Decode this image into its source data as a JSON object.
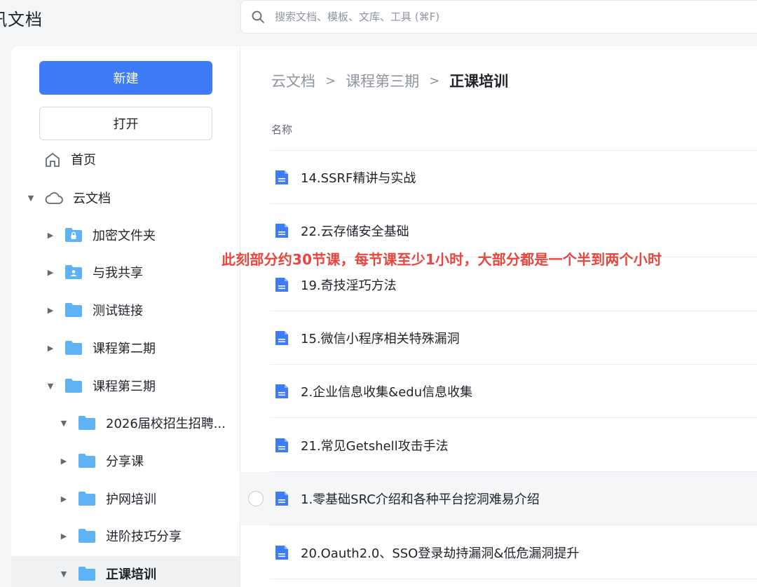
{
  "app": {
    "title": "讯文档"
  },
  "search": {
    "placeholder": "搜索文档、模板、文库、工具 (⌘F)"
  },
  "sidebar": {
    "new_label": "新建",
    "open_label": "打开",
    "home_label": "首页",
    "tree": [
      {
        "label": "云文档",
        "expanded": true
      },
      {
        "label": "加密文件夹",
        "icon": "lock-folder-icon"
      },
      {
        "label": "与我共享",
        "icon": "shared-folder-icon"
      },
      {
        "label": "测试链接"
      },
      {
        "label": "课程第二期"
      },
      {
        "label": "课程第三期",
        "expanded": true
      },
      {
        "label": "2026届校招生招聘...",
        "expanded": true
      },
      {
        "label": "分享课"
      },
      {
        "label": "护网培训"
      },
      {
        "label": "进阶技巧分享"
      },
      {
        "label": "正课培训",
        "expanded": true,
        "active": true
      }
    ]
  },
  "main": {
    "breadcrumb": [
      "云文档",
      "课程第三期",
      "正课培训"
    ],
    "column_header": "名称",
    "files": [
      "14.SSRF精讲与实战",
      "22.云存储安全基础",
      "19.奇技淫巧方法",
      "15.微信小程序相关特殊漏洞",
      "2.企业信息收集&edu信息收集",
      "21.常见Getshell攻击手法",
      "1.零基础SRC介绍和各种平台挖洞难易介绍",
      "20.Oauth2.0、SSO登录劫持漏洞&低危漏洞提升"
    ]
  },
  "annotation": "此刻部分约30节课，每节课至少1小时，大部分都是一个半到两个小时",
  "colors": {
    "accent": "#3d7bf7",
    "folder": "#5fb3f5",
    "doc": "#3d7bf7",
    "annotation": "#e8453c"
  }
}
